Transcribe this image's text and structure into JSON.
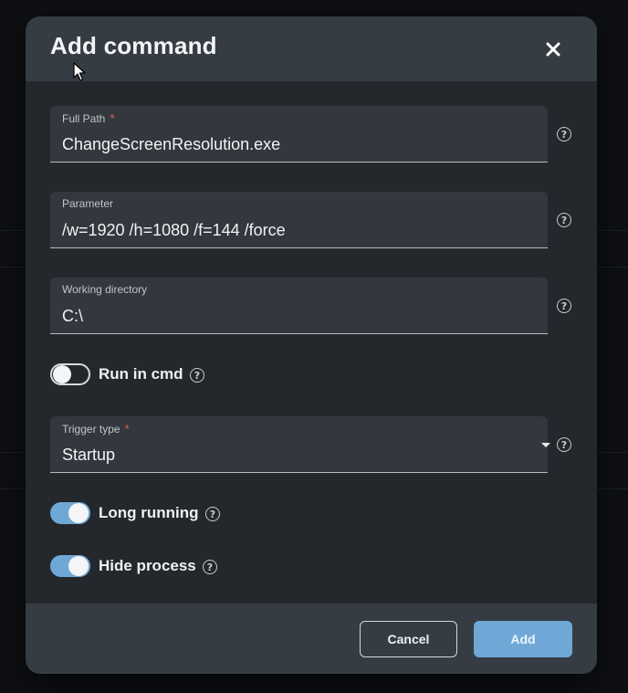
{
  "dialog": {
    "title": "Add command",
    "close_icon": "close-icon"
  },
  "fields": {
    "full_path": {
      "label": "Full Path",
      "required_mark": "*",
      "value": "ChangeScreenResolution.exe"
    },
    "parameter": {
      "label": "Parameter",
      "value": "/w=1920 /h=1080 /f=144 /force"
    },
    "working_directory": {
      "label": "Working directory",
      "value": "C:\\"
    },
    "trigger_type": {
      "label": "Trigger type",
      "required_mark": "*",
      "value": "Startup"
    }
  },
  "toggles": {
    "run_in_cmd": {
      "label": "Run in cmd",
      "checked": false
    },
    "long_running": {
      "label": "Long running",
      "checked": true
    },
    "hide_process": {
      "label": "Hide process",
      "checked": true
    }
  },
  "footer": {
    "cancel_label": "Cancel",
    "add_label": "Add"
  },
  "help_glyph": "?",
  "colors": {
    "accent": "#6fa8d6",
    "required": "#e0634f",
    "dialog_bg": "#24282d",
    "header_bg": "#363c43"
  }
}
